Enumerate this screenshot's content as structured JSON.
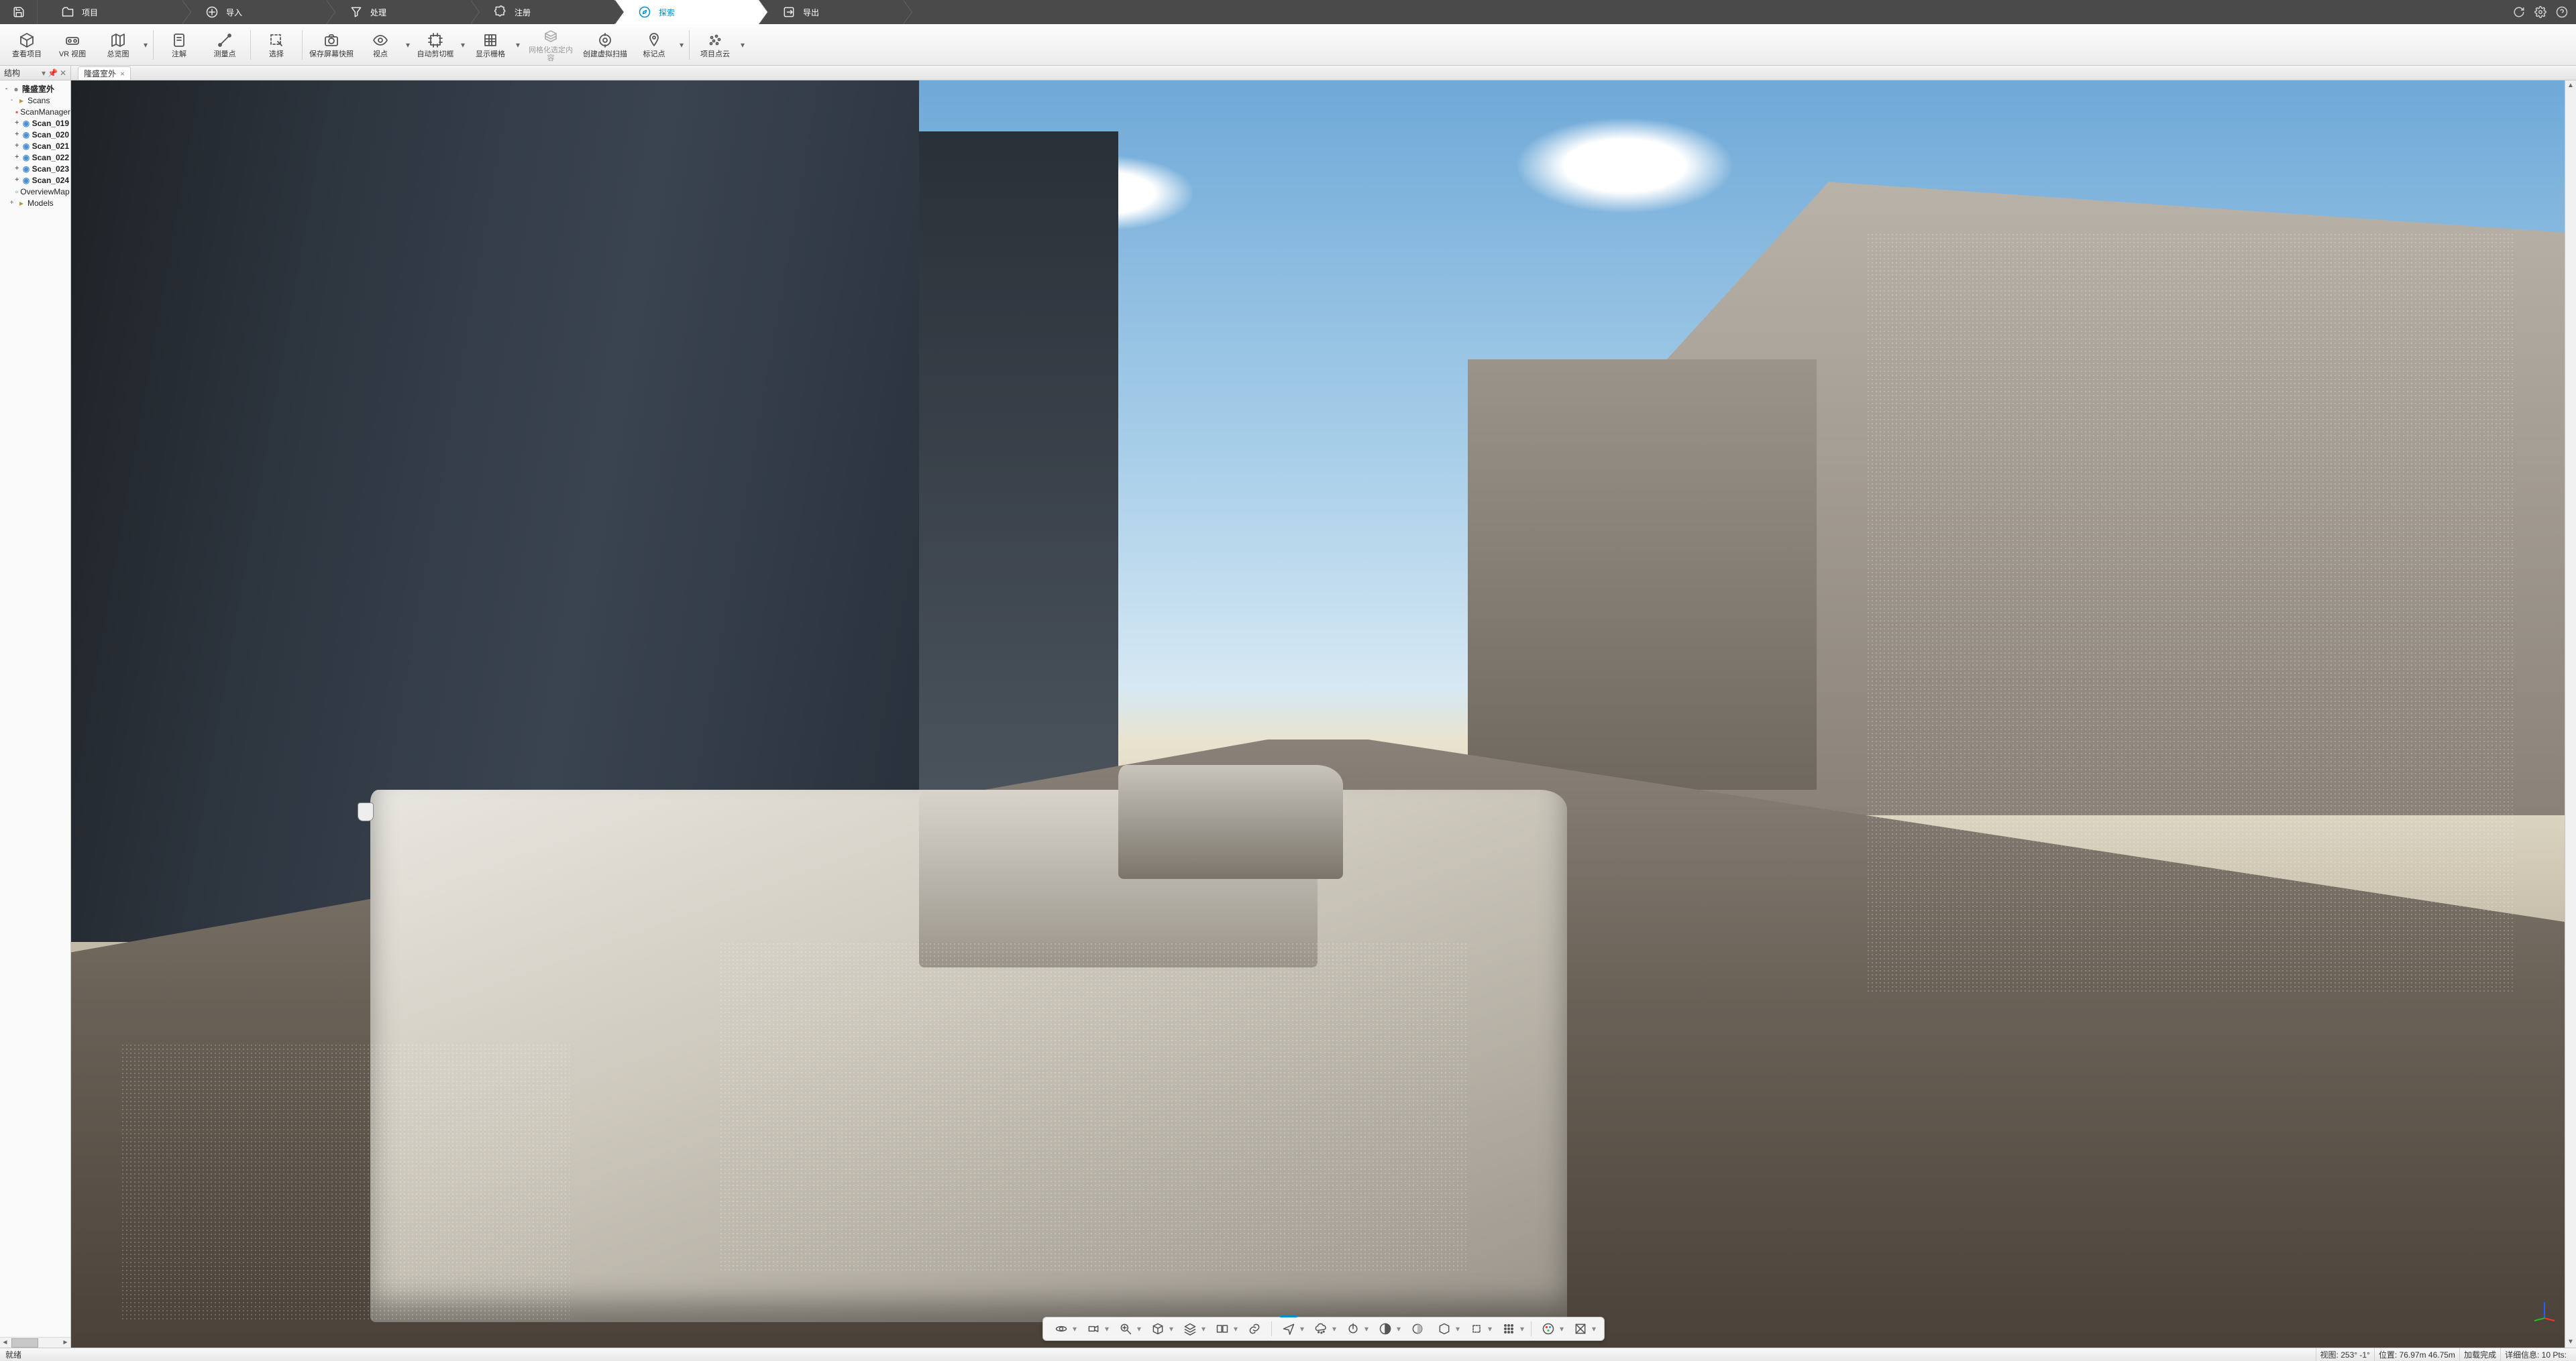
{
  "workflow": {
    "steps": [
      {
        "id": "project",
        "label": "项目",
        "icon": "folder"
      },
      {
        "id": "import",
        "label": "导入",
        "icon": "import"
      },
      {
        "id": "process",
        "label": "处理",
        "icon": "funnel"
      },
      {
        "id": "register",
        "label": "注册",
        "icon": "puzzle"
      },
      {
        "id": "explore",
        "label": "探索",
        "icon": "compass",
        "active": true
      },
      {
        "id": "export",
        "label": "导出",
        "icon": "export"
      }
    ]
  },
  "ribbon": {
    "groups": [
      {
        "items": [
          {
            "id": "view-project",
            "label": "查看项目",
            "icon": "cube"
          },
          {
            "id": "vr-view",
            "label": "VR 视图",
            "icon": "vr"
          },
          {
            "id": "overview",
            "label": "总览图",
            "icon": "map",
            "dd": true
          }
        ]
      },
      {
        "items": [
          {
            "id": "annotate",
            "label": "注解",
            "icon": "note"
          },
          {
            "id": "measure",
            "label": "测量点",
            "icon": "measure"
          }
        ]
      },
      {
        "items": [
          {
            "id": "select",
            "label": "选择",
            "icon": "select"
          }
        ]
      },
      {
        "items": [
          {
            "id": "screenshot",
            "label": "保存屏幕快照",
            "icon": "camera"
          },
          {
            "id": "viewpoint",
            "label": "视点",
            "icon": "eye",
            "dd": true
          },
          {
            "id": "clipbox",
            "label": "自动剪切框",
            "icon": "clip",
            "dd": true
          },
          {
            "id": "show-grid",
            "label": "显示栅格",
            "icon": "grid",
            "dd": true
          },
          {
            "id": "mesh-select",
            "label": "网格化选定内容",
            "icon": "mesh",
            "disabled": true
          },
          {
            "id": "virtual-scan",
            "label": "创建虚拟扫描",
            "icon": "vscan"
          },
          {
            "id": "mark-point",
            "label": "标记点",
            "icon": "pin",
            "dd": true
          }
        ]
      },
      {
        "items": [
          {
            "id": "project-cloud",
            "label": "项目点云",
            "icon": "pcloud",
            "dd": true
          }
        ]
      }
    ]
  },
  "side_panel": {
    "title": "结构",
    "tree": [
      {
        "label": "隆盛室外",
        "level": 1,
        "bold": true,
        "tw": "-",
        "icon": "dot"
      },
      {
        "label": "Scans",
        "level": 2,
        "bold": false,
        "tw": "-",
        "icon": "folder-s"
      },
      {
        "label": "ScanManager",
        "level": 3,
        "bold": false,
        "tw": "",
        "icon": "sm"
      },
      {
        "label": "Scan_019",
        "level": 3,
        "bold": true,
        "tw": "+",
        "icon": "scan"
      },
      {
        "label": "Scan_020",
        "level": 3,
        "bold": true,
        "tw": "+",
        "icon": "scan"
      },
      {
        "label": "Scan_021",
        "level": 3,
        "bold": true,
        "tw": "+",
        "icon": "scan"
      },
      {
        "label": "Scan_022",
        "level": 3,
        "bold": true,
        "tw": "+",
        "icon": "scan"
      },
      {
        "label": "Scan_023",
        "level": 3,
        "bold": true,
        "tw": "+",
        "icon": "scan"
      },
      {
        "label": "Scan_024",
        "level": 3,
        "bold": true,
        "tw": "+",
        "icon": "scan"
      },
      {
        "label": "OverviewMap",
        "level": 3,
        "bold": false,
        "tw": "",
        "icon": "ovm"
      },
      {
        "label": "Models",
        "level": 2,
        "bold": false,
        "tw": "+",
        "icon": "folder-s"
      }
    ]
  },
  "doc_tab": {
    "label": "隆盛室外"
  },
  "view_toolbar": {
    "items": [
      {
        "id": "orbit",
        "icon": "orbit",
        "dd": true
      },
      {
        "id": "camera-mode",
        "icon": "cam",
        "dd": true
      },
      {
        "id": "zoom",
        "icon": "zoom",
        "dd": true
      },
      {
        "id": "box",
        "icon": "box",
        "dd": true
      },
      {
        "id": "layers",
        "icon": "layers",
        "dd": true
      },
      {
        "id": "dual",
        "icon": "dual",
        "dd": true
      },
      {
        "id": "link",
        "icon": "link"
      },
      {
        "sep": true
      },
      {
        "id": "fly",
        "icon": "fly",
        "active": true,
        "dd": true
      },
      {
        "id": "cloud-style",
        "icon": "cstyle",
        "dd": true
      },
      {
        "id": "normals",
        "icon": "normals",
        "dd": true
      },
      {
        "id": "contrast",
        "icon": "contrast",
        "dd": true
      },
      {
        "id": "shading",
        "icon": "shading"
      },
      {
        "id": "iso",
        "icon": "iso",
        "dd": true
      },
      {
        "id": "clip2",
        "icon": "clip2",
        "dd": true
      },
      {
        "id": "grid2",
        "icon": "grid2",
        "dd": true
      },
      {
        "sep": true
      },
      {
        "id": "color",
        "icon": "color",
        "dd": true
      },
      {
        "id": "texture",
        "icon": "texture",
        "dd": true
      }
    ]
  },
  "status": {
    "ready": "就绪",
    "view_label": "视图:",
    "view_val": "253° -1°",
    "pos_label": "位置:",
    "pos_val": "76.97m 46.75m",
    "load": "加载完成",
    "detail_label": "详细信息:",
    "detail_val": "10 Pts:"
  }
}
